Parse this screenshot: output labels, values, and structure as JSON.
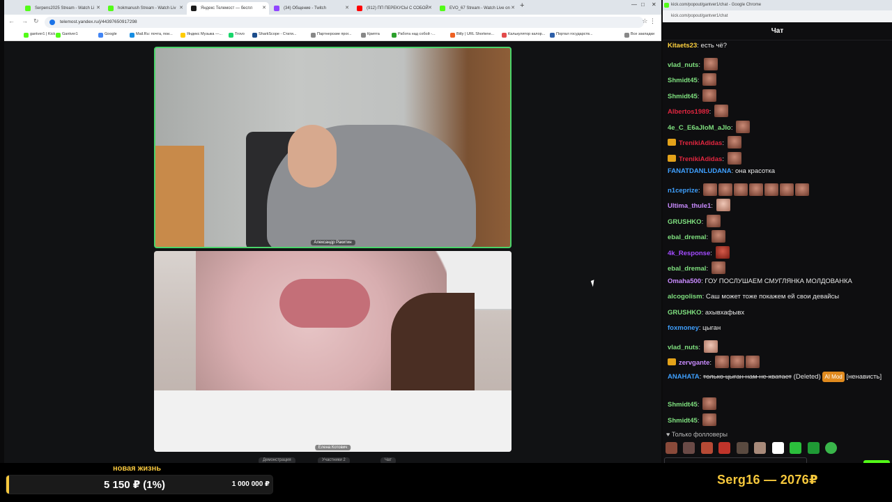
{
  "browser": {
    "tabs": [
      {
        "label": "Serpens2025 Stream - Watch Li",
        "color": "#53fc18"
      },
      {
        "label": "hokmanush Stream - Watch Liv",
        "color": "#53fc18"
      },
      {
        "label": "Яндекс Телемост — беспл",
        "color": "#1a1a1a",
        "active": true
      },
      {
        "label": "(34) Общение - Twitch",
        "color": "#9146ff"
      },
      {
        "label": "(912) ПП ПЕРЕКУСЫ С СОБОЙ",
        "color": "#ff0000"
      },
      {
        "label": "EVO_67 Stream - Watch Live on",
        "color": "#53fc18"
      }
    ],
    "new_tab": "+",
    "url": "telemost.yandex.ru/j/44397650917298",
    "bookmarks": [
      {
        "label": "gantver1 | Kick",
        "color": "#53fc18"
      },
      {
        "label": "Gantver1",
        "color": "#53fc18"
      },
      {
        "label": "Google",
        "color": "#4285f4"
      },
      {
        "label": "Mail.Ru: почта, пои...",
        "color": "#168de2"
      },
      {
        "label": "Яндекс Музыка —...",
        "color": "#ffcc00"
      },
      {
        "label": "Trovo",
        "color": "#19d66b"
      },
      {
        "label": "SharkScope - Стати...",
        "color": "#1c4d8c"
      },
      {
        "label": "Партнерские прог...",
        "color": "#888888"
      },
      {
        "label": "Крипта",
        "color": "#888888"
      },
      {
        "label": "Работа над собой -...",
        "color": "#2ca02c"
      },
      {
        "label": "Bitly | URL Shortene...",
        "color": "#ee6123"
      },
      {
        "label": "Калькулятор калор...",
        "color": "#e34b4b"
      },
      {
        "label": "Портал государств...",
        "color": "#2d5fa8"
      },
      {
        "label": "Все закладки",
        "color": "#888888"
      }
    ],
    "call": {
      "participant1": "Александр Ракитин",
      "participant2": "Елена Котович",
      "controls": [
        "Демонстрация",
        "Участники 2",
        "Чат"
      ]
    }
  },
  "goal": {
    "title": "новая жизнь",
    "current": "5 150 ₽ (1%)",
    "target": "1 000 000 ₽",
    "progress_fraction": 0.01,
    "accent": "#f6c83c"
  },
  "top_donator": "Serg16 — 2076₽",
  "chat": {
    "window_title": "kick.com/popout/gantver1/chat - Google Chrome",
    "url": "kick.com/popout/gantver1/chat",
    "header": "Чат",
    "messages": [
      {
        "user": "Kitaets23",
        "color": "#ffd23f",
        "text": "есть чё?",
        "emotes": 0
      },
      {
        "user": "vlad_nuts",
        "color": "#7fe07f",
        "text": "",
        "emotes": 1
      },
      {
        "user": "Shmidt45",
        "color": "#7fe07f",
        "text": "",
        "emotes": 1
      },
      {
        "user": "Shmidt45",
        "color": "#7fe07f",
        "text": "",
        "emotes": 1
      },
      {
        "user": "Albertos1989",
        "color": "#e0263f",
        "text": "",
        "emotes": 1
      },
      {
        "user": "4e_C_E6aJIoM_aJIo",
        "color": "#7fe07f",
        "text": "",
        "emotes": 1
      },
      {
        "user": "TrenikiAdidas",
        "color": "#e0263f",
        "text": "",
        "emotes": 1,
        "badge": true
      },
      {
        "user": "TrenikiAdidas",
        "color": "#e0263f",
        "text": "",
        "emotes": 1,
        "badge": true
      },
      {
        "user": "FANATDANLUDANA",
        "color": "#3fa0ff",
        "text": "она красотка",
        "emotes": 0
      },
      {
        "user": "n1ceprize",
        "color": "#3fa0ff",
        "text": "",
        "emotes": 7
      },
      {
        "user": "Ultima_thule1",
        "color": "#c98bff",
        "text": "",
        "emotes": 1
      },
      {
        "user": "GRUSHKO",
        "color": "#7fe07f",
        "text": "",
        "emotes": 1
      },
      {
        "user": "ebal_dremal",
        "color": "#7fe07f",
        "text": "",
        "emotes": 1
      },
      {
        "user": "4k_Response",
        "color": "#a34bff",
        "text": "",
        "emotes": 1
      },
      {
        "user": "ebal_dremal",
        "color": "#7fe07f",
        "text": "",
        "emotes": 1
      },
      {
        "user": "Omaha500",
        "color": "#c98bff",
        "text": "ГОУ ПОСЛУШАЕМ СМУГЛЯНКА МОЛДОВАНКА",
        "emotes": 0
      },
      {
        "user": "alcogolism",
        "color": "#7fe07f",
        "text": "Саш может тоже покажем ей свои девайсы",
        "emotes": 0
      },
      {
        "user": "GRUSHKO",
        "color": "#7fe07f",
        "text": "ахывхафывх",
        "emotes": 0
      },
      {
        "user": "foxmoney",
        "color": "#3fa0ff",
        "text": "цыган",
        "emotes": 0
      },
      {
        "user": "vlad_nuts",
        "color": "#7fe07f",
        "text": "",
        "emotes": 1
      },
      {
        "user": "zervgante",
        "color": "#c98bff",
        "text": "",
        "emotes": 3,
        "badge": true
      },
      {
        "user": "ANAHATA",
        "color": "#3fa0ff",
        "text": "только цыган нам не хватает",
        "emotes": 0,
        "deleted": true,
        "deleted_label": "(Deleted)",
        "mod_label": "AI Mod",
        "reason": "[ненависть]"
      },
      {
        "user": "Shmidt45",
        "color": "#7fe07f",
        "text": "",
        "emotes": 1
      },
      {
        "user": "Shmidt45",
        "color": "#7fe07f",
        "text": "",
        "emotes": 1
      }
    ],
    "followers_only": "Только фолловеры"
  }
}
